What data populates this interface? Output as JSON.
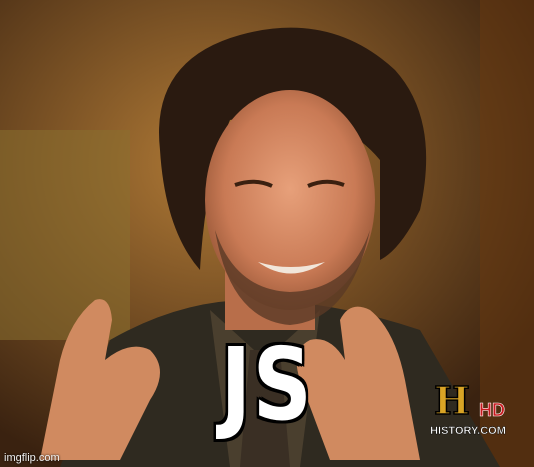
{
  "meme": {
    "caption": "JS",
    "watermark": "imgflip.com",
    "logo": {
      "letter": "H",
      "badge": "HD",
      "site": "HISTORY.COM"
    }
  },
  "colors": {
    "caption_fill": "#ffffff",
    "caption_outline": "#000000",
    "logo_gold": "#d9a425",
    "logo_red": "#c8191e"
  }
}
